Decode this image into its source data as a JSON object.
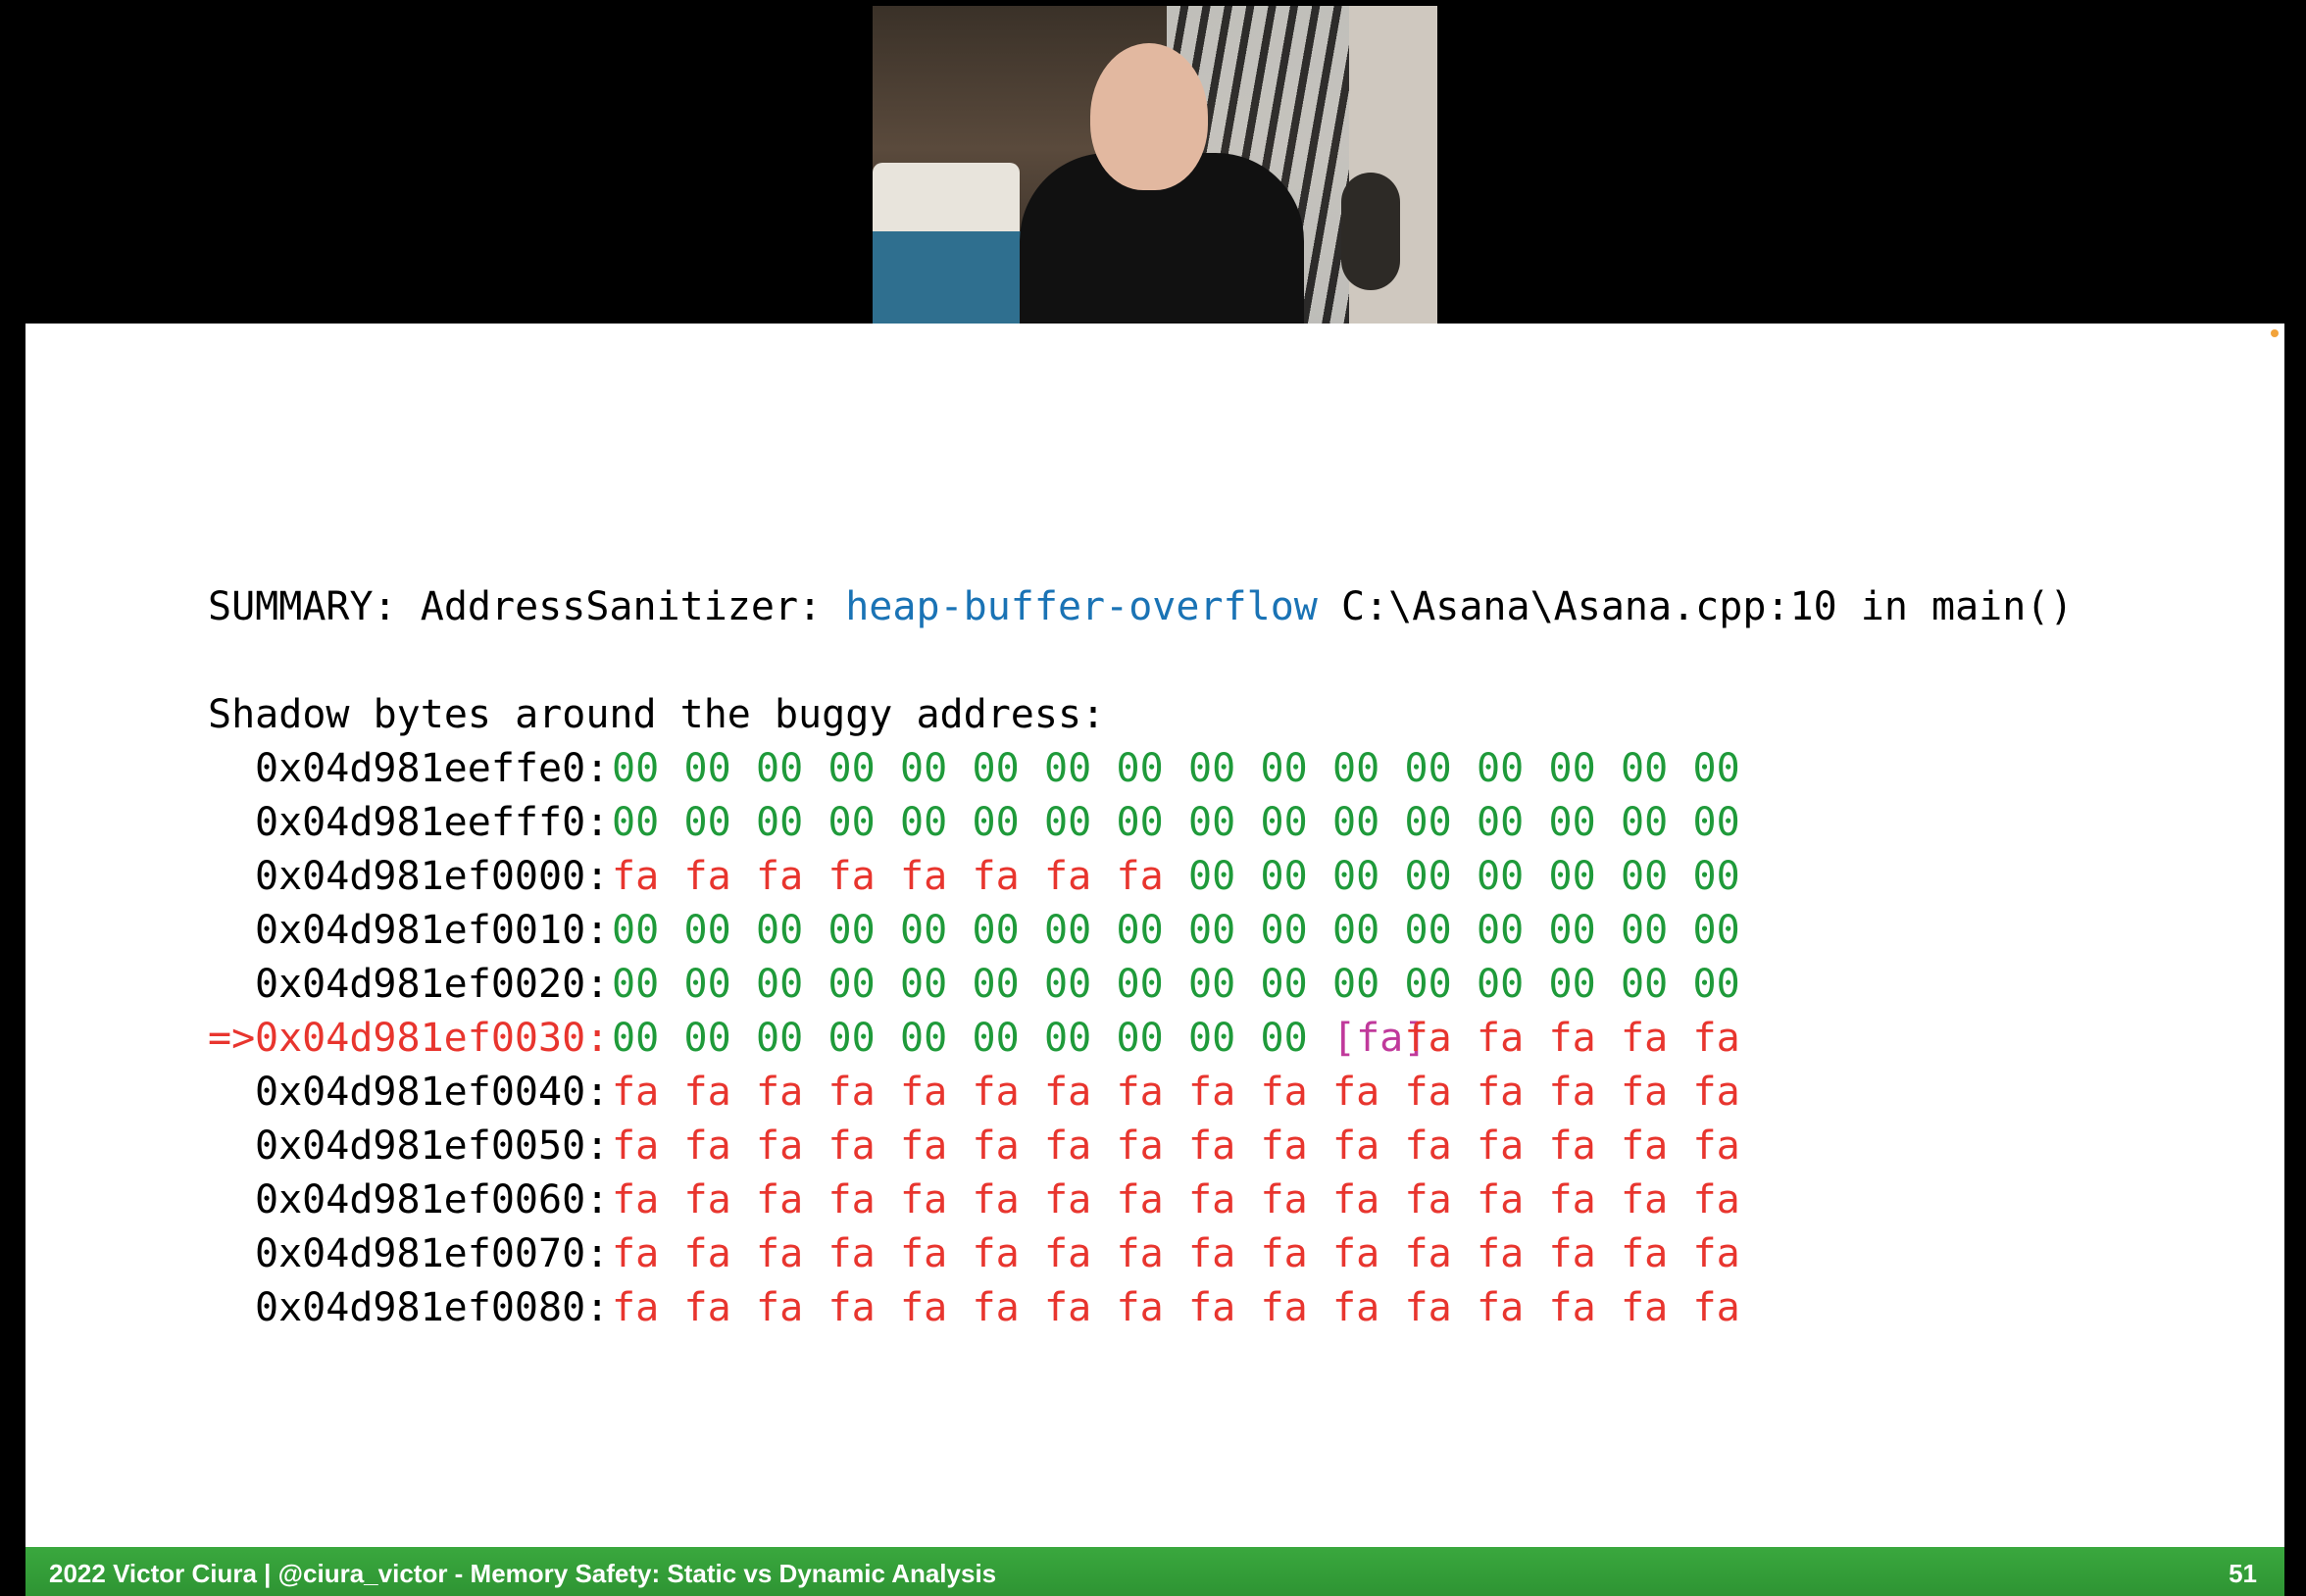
{
  "summary": {
    "prefix": "SUMMARY: AddressSanitizer: ",
    "error_type": "heap-buffer-overflow",
    "location": " C:\\Asana\\Asana.cpp:10 in main()"
  },
  "shadow": {
    "title": "Shadow bytes around the buggy address:",
    "marker": "=>",
    "rows": [
      {
        "addr": "0x04d981eeffe0:",
        "bytes": [
          "00",
          "00",
          "00",
          "00",
          "00",
          "00",
          "00",
          "00",
          "00",
          "00",
          "00",
          "00",
          "00",
          "00",
          "00",
          "00"
        ]
      },
      {
        "addr": "0x04d981eefff0:",
        "bytes": [
          "00",
          "00",
          "00",
          "00",
          "00",
          "00",
          "00",
          "00",
          "00",
          "00",
          "00",
          "00",
          "00",
          "00",
          "00",
          "00"
        ]
      },
      {
        "addr": "0x04d981ef0000:",
        "bytes": [
          "fa",
          "fa",
          "fa",
          "fa",
          "fa",
          "fa",
          "fa",
          "fa",
          "00",
          "00",
          "00",
          "00",
          "00",
          "00",
          "00",
          "00"
        ]
      },
      {
        "addr": "0x04d981ef0010:",
        "bytes": [
          "00",
          "00",
          "00",
          "00",
          "00",
          "00",
          "00",
          "00",
          "00",
          "00",
          "00",
          "00",
          "00",
          "00",
          "00",
          "00"
        ]
      },
      {
        "addr": "0x04d981ef0020:",
        "bytes": [
          "00",
          "00",
          "00",
          "00",
          "00",
          "00",
          "00",
          "00",
          "00",
          "00",
          "00",
          "00",
          "00",
          "00",
          "00",
          "00"
        ]
      },
      {
        "addr": "0x04d981ef0030:",
        "current": true,
        "bytes": [
          "00",
          "00",
          "00",
          "00",
          "00",
          "00",
          "00",
          "00",
          "00",
          "00",
          "[fa]",
          "fa",
          "fa",
          "fa",
          "fa",
          "fa"
        ]
      },
      {
        "addr": "0x04d981ef0040:",
        "bytes": [
          "fa",
          "fa",
          "fa",
          "fa",
          "fa",
          "fa",
          "fa",
          "fa",
          "fa",
          "fa",
          "fa",
          "fa",
          "fa",
          "fa",
          "fa",
          "fa"
        ]
      },
      {
        "addr": "0x04d981ef0050:",
        "bytes": [
          "fa",
          "fa",
          "fa",
          "fa",
          "fa",
          "fa",
          "fa",
          "fa",
          "fa",
          "fa",
          "fa",
          "fa",
          "fa",
          "fa",
          "fa",
          "fa"
        ]
      },
      {
        "addr": "0x04d981ef0060:",
        "bytes": [
          "fa",
          "fa",
          "fa",
          "fa",
          "fa",
          "fa",
          "fa",
          "fa",
          "fa",
          "fa",
          "fa",
          "fa",
          "fa",
          "fa",
          "fa",
          "fa"
        ]
      },
      {
        "addr": "0x04d981ef0070:",
        "bytes": [
          "fa",
          "fa",
          "fa",
          "fa",
          "fa",
          "fa",
          "fa",
          "fa",
          "fa",
          "fa",
          "fa",
          "fa",
          "fa",
          "fa",
          "fa",
          "fa"
        ]
      },
      {
        "addr": "0x04d981ef0080:",
        "bytes": [
          "fa",
          "fa",
          "fa",
          "fa",
          "fa",
          "fa",
          "fa",
          "fa",
          "fa",
          "fa",
          "fa",
          "fa",
          "fa",
          "fa",
          "fa",
          "fa"
        ]
      }
    ]
  },
  "footer": {
    "left": "2022 Victor Ciura | @ciura_victor - Memory Safety: Static vs Dynamic Analysis",
    "page": "51"
  },
  "colors": {
    "zero_byte": "#1f9a3a",
    "redzone_byte": "#e8352e",
    "buggy_byte": "#c0399b",
    "accent_blue": "#1a73b5",
    "footer_green": "#34a038"
  },
  "icons": {
    "webcam": "presenter-webcam-video"
  }
}
